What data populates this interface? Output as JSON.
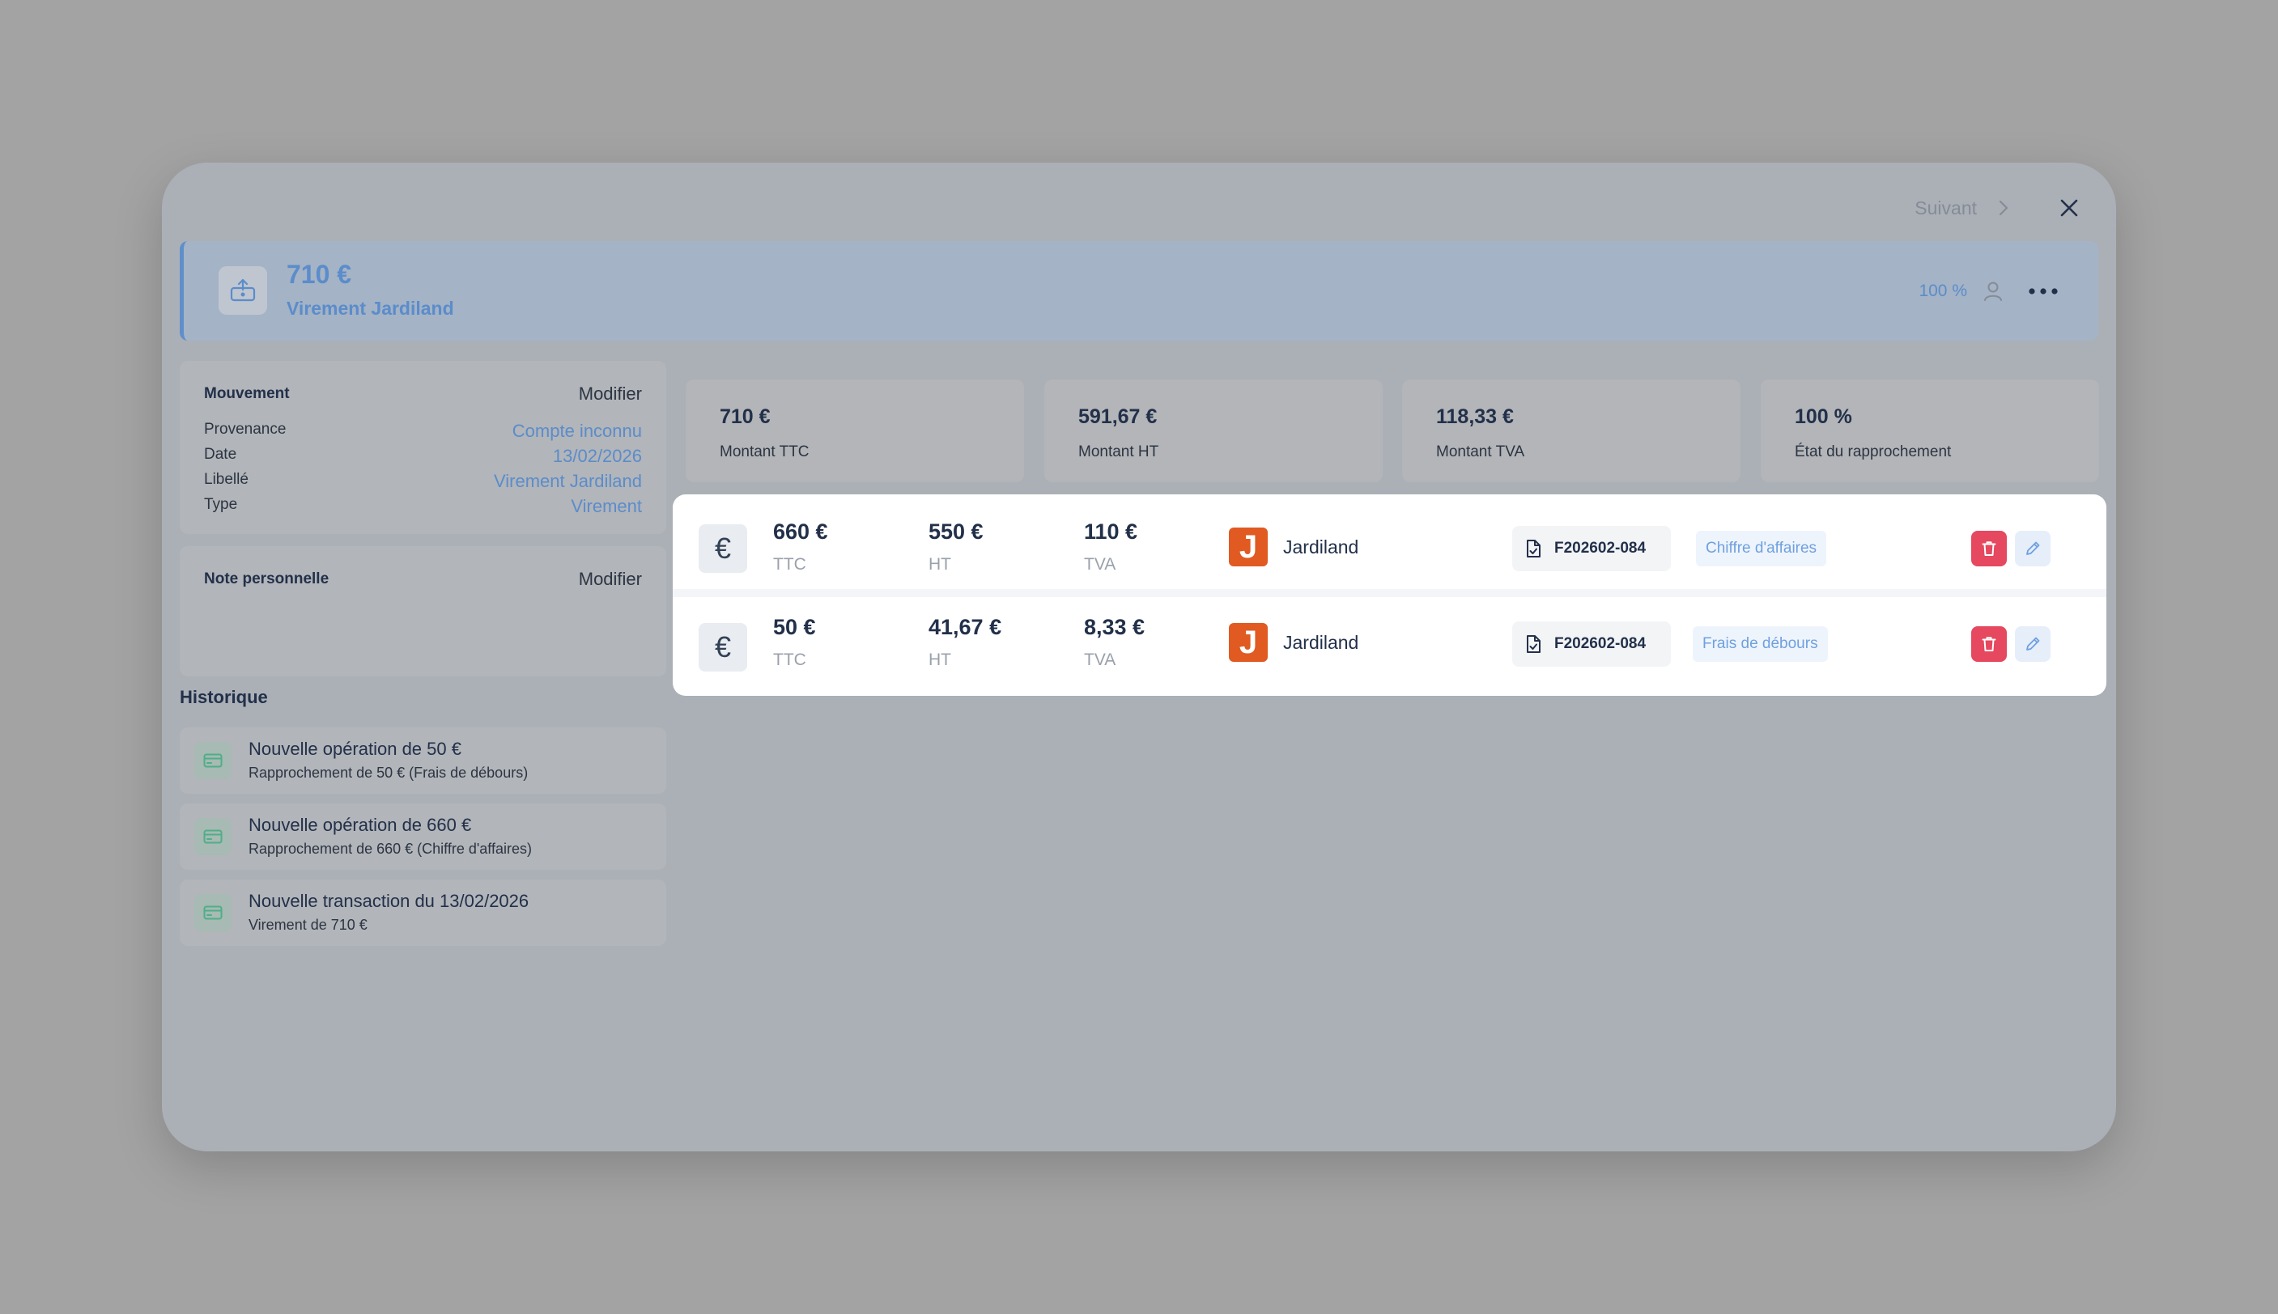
{
  "topbar": {
    "next_label": "Suivant"
  },
  "header": {
    "amount": "710 €",
    "label": "Virement Jardiland",
    "percent": "100 %"
  },
  "mouvement": {
    "title": "Mouvement",
    "action": "Modifier",
    "rows": [
      {
        "key": "Provenance",
        "value": "Compte inconnu"
      },
      {
        "key": "Date",
        "value": "13/02/2026"
      },
      {
        "key": "Libellé",
        "value": "Virement Jardiland"
      },
      {
        "key": "Type",
        "value": "Virement"
      }
    ]
  },
  "note": {
    "title": "Note personnelle",
    "action": "Modifier"
  },
  "historique": {
    "title": "Historique",
    "items": [
      {
        "title": "Nouvelle opération de 50 €",
        "subtitle": "Rapprochement de 50 € (Frais de débours)"
      },
      {
        "title": "Nouvelle opération de 660 €",
        "subtitle": "Rapprochement de 660 € (Chiffre d'affaires)"
      },
      {
        "title": "Nouvelle transaction du 13/02/2026",
        "subtitle": "Virement de 710 €"
      }
    ]
  },
  "stats": [
    {
      "value": "710 €",
      "label": "Montant TTC"
    },
    {
      "value": "591,67 €",
      "label": "Montant HT"
    },
    {
      "value": "118,33 €",
      "label": "Montant TVA"
    },
    {
      "value": "100 %",
      "label": "État du rapprochement"
    }
  ],
  "operations": [
    {
      "euro_glyph": "€",
      "ttc": "660 €",
      "ttc_label": "TTC",
      "ht": "550 €",
      "ht_label": "HT",
      "tva": "110 €",
      "tva_label": "TVA",
      "logo_letter": "J",
      "vendor": "Jardiland",
      "document": "F202602-084",
      "category": "Chiffre d'affaires"
    },
    {
      "euro_glyph": "€",
      "ttc": "50 €",
      "ttc_label": "TTC",
      "ht": "41,67 €",
      "ht_label": "HT",
      "tva": "8,33 €",
      "tva_label": "TVA",
      "logo_letter": "J",
      "vendor": "Jardiland",
      "document": "F202602-084",
      "category": "Frais de débours"
    }
  ],
  "colors": {
    "accent": "#5b8ccb",
    "danger": "#e5485f",
    "vendor_logo": "#e05a22"
  },
  "icons": {
    "next": "chevron-right-icon",
    "close": "close-icon",
    "header": "bank-upload-icon",
    "user": "user-icon",
    "more": "more-horizontal-icon",
    "history": "card-icon",
    "document": "document-check-icon",
    "delete": "trash-icon",
    "edit": "pencil-icon"
  }
}
